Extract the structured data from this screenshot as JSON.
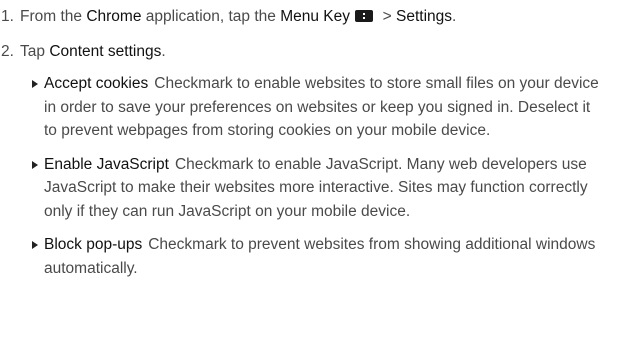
{
  "steps": [
    {
      "number": "1.",
      "parts": {
        "a": "From the ",
        "b": "Chrome",
        "c": " application, tap the ",
        "d": "Menu Key",
        "e": " > ",
        "f": "Settings",
        "g": "."
      },
      "icon": "menu-key-icon"
    },
    {
      "number": "2.",
      "parts": {
        "a": "Tap ",
        "b": "Content settings",
        "c": "."
      }
    }
  ],
  "bullets": [
    {
      "term": "Accept cookies",
      "text": "Checkmark to enable websites to store small files on your device in order to save your preferences on websites or keep you signed in. Deselect it to prevent webpages from storing cookies on your mobile device."
    },
    {
      "term": "Enable JavaScript",
      "text": "Checkmark to enable JavaScript. Many web developers use JavaScript to make their websites more interactive. Sites may function correctly only if they can run JavaScript on your mobile device."
    },
    {
      "term": "Block pop-ups",
      "text": "Checkmark to prevent websites from showing additional windows automatically."
    }
  ]
}
